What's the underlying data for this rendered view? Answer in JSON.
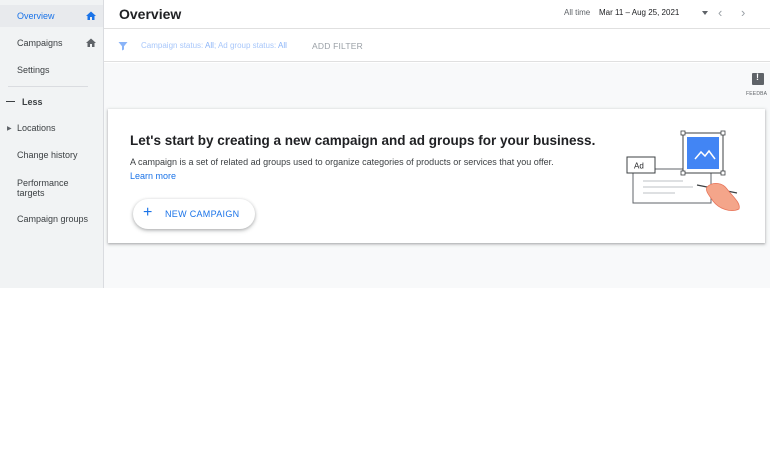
{
  "sidebar": {
    "items": [
      {
        "label": "Overview"
      },
      {
        "label": "Campaigns"
      },
      {
        "label": "Settings"
      },
      {
        "label": "Less"
      },
      {
        "label": "Locations"
      },
      {
        "label": "Change history"
      },
      {
        "label": "Performance targets"
      },
      {
        "label": "Campaign groups"
      }
    ]
  },
  "header": {
    "title": "Overview",
    "date_label": "All time",
    "date_range": "Mar 11 – Aug 25, 2021",
    "prev_icon": "chevron-left-icon",
    "next_icon": "chevron-right-icon"
  },
  "filter": {
    "icon": "filter-icon",
    "campaign_status_label": "Campaign status: ",
    "campaign_status_value": "All",
    "ad_group_status_label": "; Ad group status: ",
    "ad_group_status_value": "All",
    "add_filter": "ADD FILTER"
  },
  "feedback": {
    "label": "FEEDBA"
  },
  "card": {
    "title": "Let's start by creating a new campaign and ad groups for your business.",
    "description": "A campaign is a set of related ad groups used to organize categories of products or services that you offer.",
    "learn_more": "Learn more",
    "button_label": "NEW CAMPAIGN",
    "illustration_ad_text": "Ad"
  },
  "colors": {
    "accent": "#1a73e8",
    "sidebar_bg": "#f1f3f4",
    "filter_value": "#8ab4f8"
  }
}
